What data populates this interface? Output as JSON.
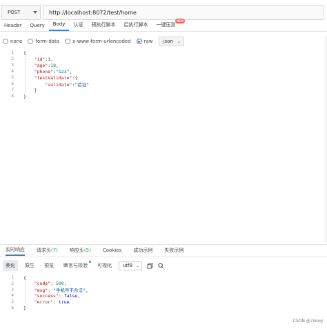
{
  "request": {
    "method": "POST",
    "url": "http://localhost:8072/test/home"
  },
  "req_tabs": [
    {
      "label": "Header",
      "active": false
    },
    {
      "label": "Query",
      "active": false
    },
    {
      "label": "Body",
      "active": true
    },
    {
      "label": "认证",
      "active": false
    },
    {
      "label": "预执行脚本",
      "active": false
    },
    {
      "label": "后执行脚本",
      "active": false
    },
    {
      "label": "一键压测",
      "active": false,
      "badge": "NEW"
    }
  ],
  "body_types": {
    "options": [
      "none",
      "form-data",
      "x-www-form-urlencoded",
      "raw"
    ],
    "selected": "raw",
    "format": "json"
  },
  "request_body": {
    "lines": [
      {
        "n": "1",
        "text": "{"
      },
      {
        "n": "2",
        "text": "    \"id\":1,"
      },
      {
        "n": "3",
        "text": "    \"age\":18,"
      },
      {
        "n": "4",
        "text": "    \"phone\":\"123\","
      },
      {
        "n": "5",
        "text": "    \"testValidate\":{"
      },
      {
        "n": "6",
        "text": "        \"validate\":\"验证\""
      },
      {
        "n": "7",
        "text": "    }"
      },
      {
        "n": "8",
        "text": "}"
      }
    ]
  },
  "resp_tabs": [
    {
      "label": "实时响应",
      "count": "",
      "active": true
    },
    {
      "label": "请求头",
      "count": "(7)",
      "active": false
    },
    {
      "label": "响应头",
      "count": "(5)",
      "active": false
    },
    {
      "label": "Cookies",
      "count": "",
      "active": false
    },
    {
      "label": "成功示例",
      "count": "",
      "active": false
    },
    {
      "label": "失败示例",
      "count": "",
      "active": false
    }
  ],
  "resp_toolbar": {
    "buttons": [
      "美化",
      "原生",
      "预览",
      "断言与校验",
      "可视化"
    ],
    "active": "美化",
    "encoding": "utf8"
  },
  "response_body": {
    "lines": [
      {
        "n": "1",
        "text": "{"
      },
      {
        "n": "2",
        "text": "    \"code\": 500,"
      },
      {
        "n": "3",
        "text": "    \"msg\": \"手机号不合法\","
      },
      {
        "n": "4",
        "text": "    \"success\": false,"
      },
      {
        "n": "5",
        "text": "    \"error\": true"
      },
      {
        "n": "6",
        "text": "}"
      }
    ]
  },
  "watermark": "CSDN @7song",
  "colors": {
    "accent": "#3d7bd9",
    "json_key": "#a31515",
    "json_string": "#0451a5",
    "json_number": "#098658",
    "json_bool": "#0000ff",
    "count": "#2a9d5a"
  }
}
